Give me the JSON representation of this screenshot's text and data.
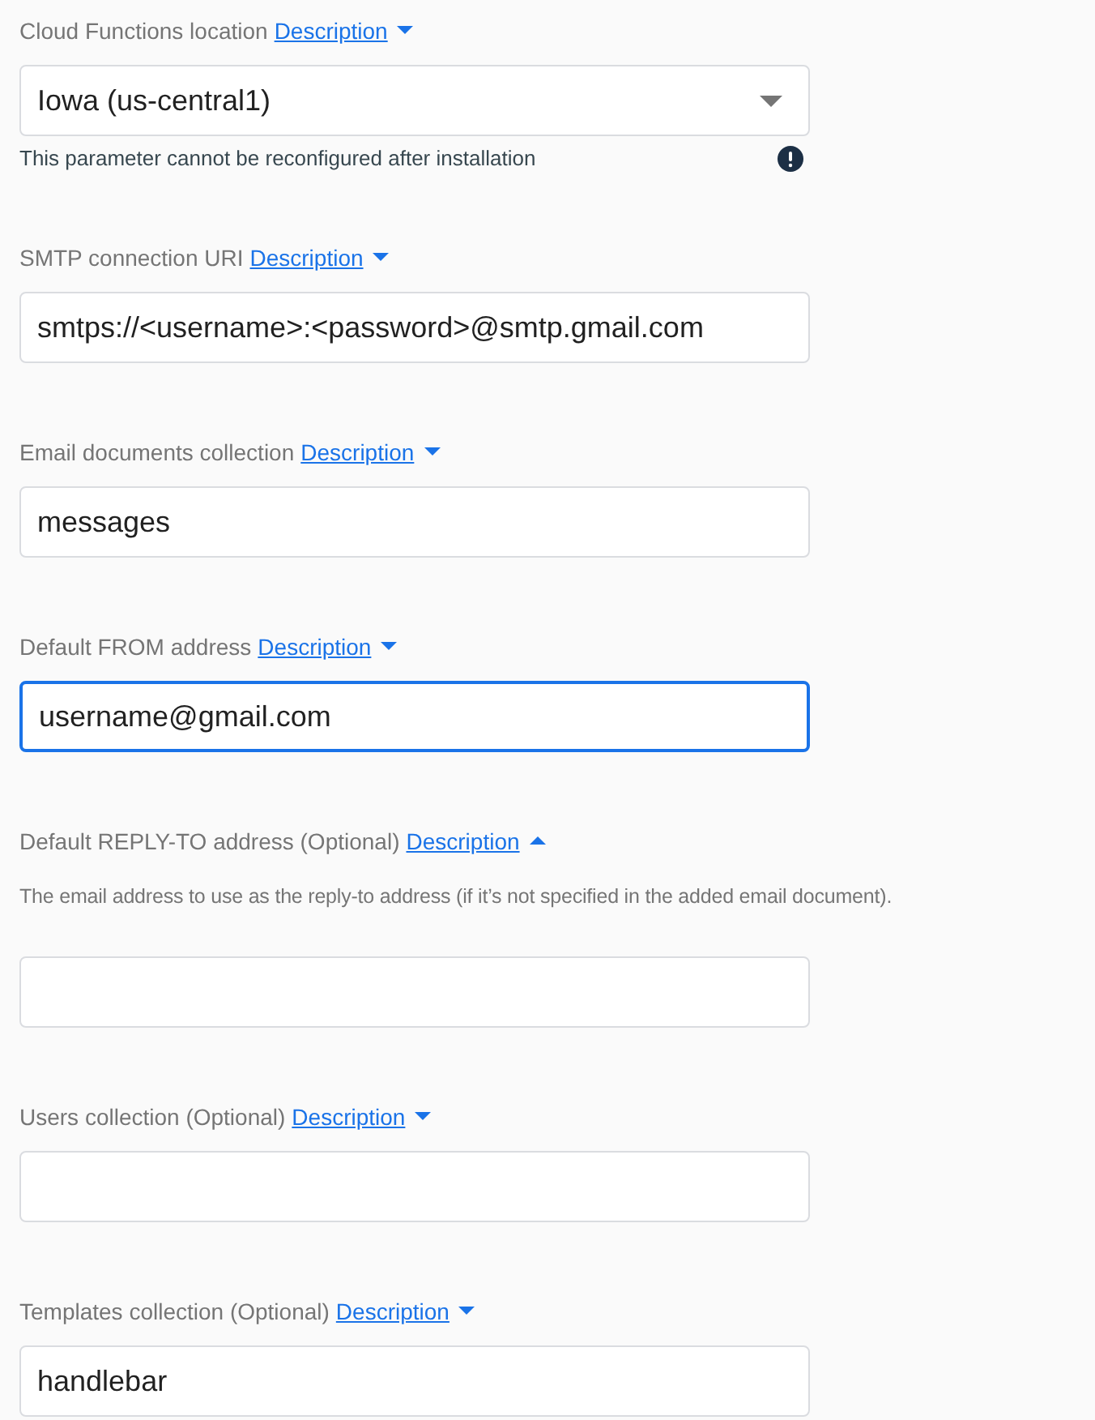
{
  "fields": [
    {
      "kind": "select",
      "label": "Cloud Functions location",
      "link": "Description",
      "expanded": false,
      "value": "Iowa (us-central1)",
      "focused": false,
      "hint": "This parameter cannot be reconfigured after installation"
    },
    {
      "kind": "text",
      "label": "SMTP connection URI",
      "link": "Description",
      "expanded": false,
      "value": "smtps://<username>:<password>@smtp.gmail.com",
      "focused": false
    },
    {
      "kind": "text",
      "label": "Email documents collection",
      "link": "Description",
      "expanded": false,
      "value": "messages",
      "focused": false
    },
    {
      "kind": "text",
      "label": "Default FROM address",
      "link": "Description",
      "expanded": false,
      "value": "username@gmail.com",
      "focused": true
    },
    {
      "kind": "text",
      "label": "Default REPLY-TO address (Optional)",
      "link": "Description",
      "expanded": true,
      "description": "The email address to use as the reply-to address (if it’s not specified in the added email document).",
      "focused": false
    },
    {
      "kind": "text",
      "label": "Users collection (Optional)",
      "link": "Description",
      "expanded": false,
      "focused": false
    },
    {
      "kind": "text",
      "label": "Templates collection (Optional)",
      "link": "Description",
      "expanded": false,
      "value": "handlebar",
      "focused": false
    }
  ]
}
